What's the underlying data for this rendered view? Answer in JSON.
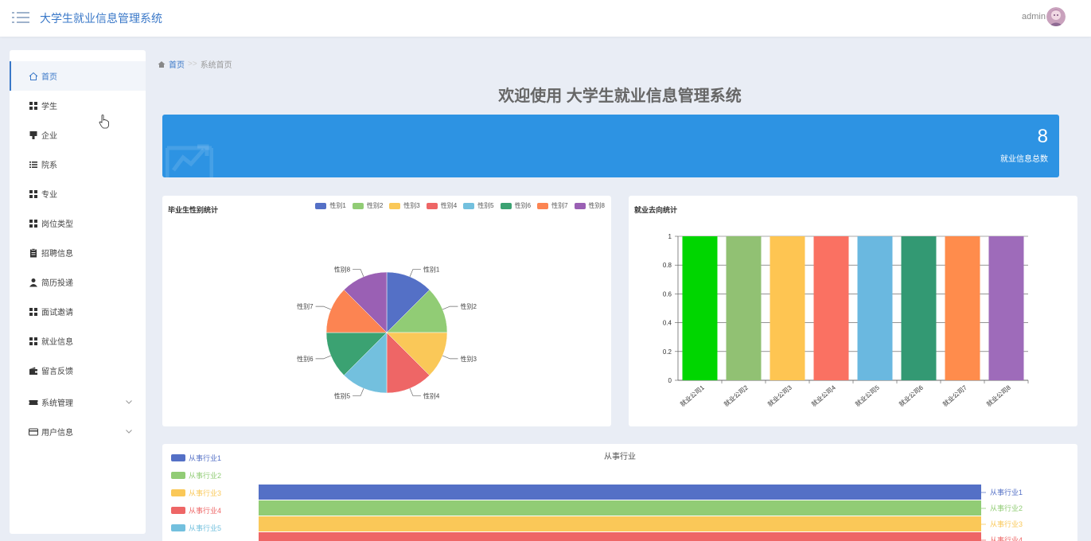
{
  "header": {
    "app_title": "大学生就业信息管理系统",
    "username": "admin"
  },
  "sidebar": {
    "items": [
      {
        "label": "首页",
        "icon": "home-icon"
      },
      {
        "label": "学生",
        "icon": "grid-icon"
      },
      {
        "label": "企业",
        "icon": "building-icon"
      },
      {
        "label": "院系",
        "icon": "list-icon"
      },
      {
        "label": "专业",
        "icon": "grid-icon"
      },
      {
        "label": "岗位类型",
        "icon": "grid-icon"
      },
      {
        "label": "招聘信息",
        "icon": "clipboard-icon"
      },
      {
        "label": "简历投递",
        "icon": "user-icon"
      },
      {
        "label": "面试邀请",
        "icon": "grid-icon"
      },
      {
        "label": "就业信息",
        "icon": "grid-icon"
      },
      {
        "label": "留言反馈",
        "icon": "wallet-icon"
      },
      {
        "label": "系统管理",
        "icon": "ticket-icon"
      },
      {
        "label": "用户信息",
        "icon": "card-icon"
      }
    ]
  },
  "breadcrumb": {
    "home": "首页",
    "separator": ">>",
    "current": "系统首页"
  },
  "welcome_title": "欢迎使用 大学生就业信息管理系统",
  "stat": {
    "value": "8",
    "label": "就业信息总数"
  },
  "colors": {
    "accent": "#3a78c8",
    "stat_bg": "#2d93e3",
    "palette": [
      "#5470c6",
      "#91cc75",
      "#fac858",
      "#ee6666",
      "#73c0de",
      "#3ba272",
      "#fc8452",
      "#9a60b4"
    ]
  },
  "chart_data": [
    {
      "type": "pie",
      "title": "毕业生性别统计",
      "categories": [
        "性别1",
        "性别2",
        "性别3",
        "性别4",
        "性别5",
        "性别6",
        "性别7",
        "性别8"
      ],
      "values": [
        1,
        1,
        1,
        1,
        1,
        1,
        1,
        1
      ],
      "colors": [
        "#5470c6",
        "#91cc75",
        "#fac858",
        "#ee6666",
        "#73c0de",
        "#3ba272",
        "#fc8452",
        "#9a60b4"
      ],
      "legend": "top-right"
    },
    {
      "type": "bar",
      "title": "就业去向统计",
      "categories": [
        "就业公司1",
        "就业公司2",
        "就业公司3",
        "就业公司4",
        "就业公司5",
        "就业公司6",
        "就业公司7",
        "就业公司8"
      ],
      "values": [
        1,
        1,
        1,
        1,
        1,
        1,
        1,
        1
      ],
      "colors": [
        "#00d600",
        "#91c173",
        "#fec552",
        "#fa7162",
        "#6ab8e0",
        "#339973",
        "#ff8c4c",
        "#9e6bba"
      ],
      "ylim": [
        0,
        1
      ],
      "yticks": [
        "0",
        "0.2",
        "0.4",
        "0.6",
        "0.8",
        "1"
      ],
      "grid": true
    },
    {
      "type": "bar",
      "orientation": "horizontal",
      "title": "从事行业",
      "categories": [
        "从事行业1",
        "从事行业2",
        "从事行业3",
        "从事行业4",
        "从事行业5"
      ],
      "values": [
        1,
        1,
        1,
        1,
        1
      ],
      "colors": [
        "#5470c6",
        "#91cc75",
        "#fac858",
        "#ee6666",
        "#73c0de"
      ],
      "legend": "left"
    }
  ]
}
